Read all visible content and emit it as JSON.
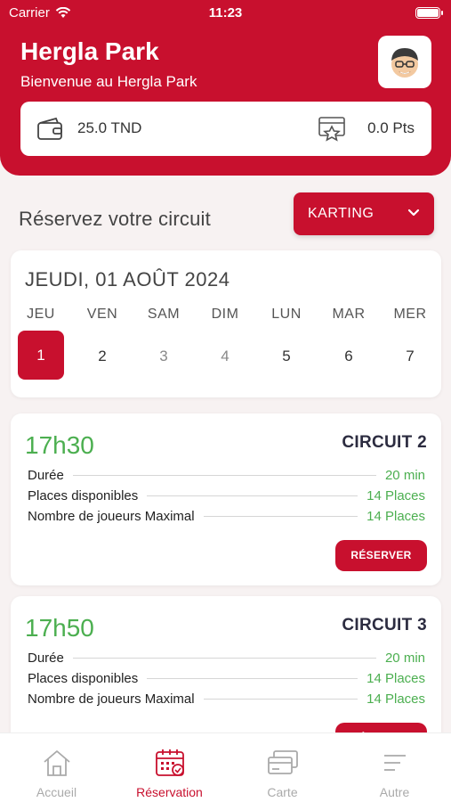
{
  "status_bar": {
    "carrier": "Carrier",
    "time": "11:23"
  },
  "header": {
    "title": "Hergla Park",
    "subtitle": "Bienvenue au Hergla Park",
    "balance": "25.0 TND",
    "points": "0.0 Pts"
  },
  "reservation": {
    "section_title": "Réservez votre circuit",
    "category": "KARTING"
  },
  "calendar": {
    "date_title": "JEUDI, 01 AOÛT 2024",
    "days": [
      {
        "name": "JEU",
        "num": "1"
      },
      {
        "name": "VEN",
        "num": "2"
      },
      {
        "name": "SAM",
        "num": "3"
      },
      {
        "name": "DIM",
        "num": "4"
      },
      {
        "name": "LUN",
        "num": "5"
      },
      {
        "name": "MAR",
        "num": "6"
      },
      {
        "name": "MER",
        "num": "7"
      }
    ]
  },
  "sessions": [
    {
      "time": "17h30",
      "circuit": "CIRCUIT 2",
      "rows": [
        {
          "label": "Durée",
          "value": "20 min"
        },
        {
          "label": "Places disponibles",
          "value": "14 Places"
        },
        {
          "label": "Nombre de joueurs Maximal",
          "value": "14 Places"
        }
      ],
      "button": "RÉSERVER"
    },
    {
      "time": "17h50",
      "circuit": "CIRCUIT 3",
      "rows": [
        {
          "label": "Durée",
          "value": "20 min"
        },
        {
          "label": "Places disponibles",
          "value": "14 Places"
        },
        {
          "label": "Nombre de joueurs Maximal",
          "value": "14 Places"
        }
      ],
      "button": "RÉSERVER"
    }
  ],
  "tabbar": {
    "items": [
      {
        "label": "Accueil",
        "icon": "home-icon"
      },
      {
        "label": "Réservation",
        "icon": "calendar-icon"
      },
      {
        "label": "Carte",
        "icon": "cards-icon"
      },
      {
        "label": "Autre",
        "icon": "menu-icon"
      }
    ]
  },
  "colors": {
    "primary": "#c8102e",
    "success": "#4caf50",
    "background": "#f7f2f2"
  }
}
